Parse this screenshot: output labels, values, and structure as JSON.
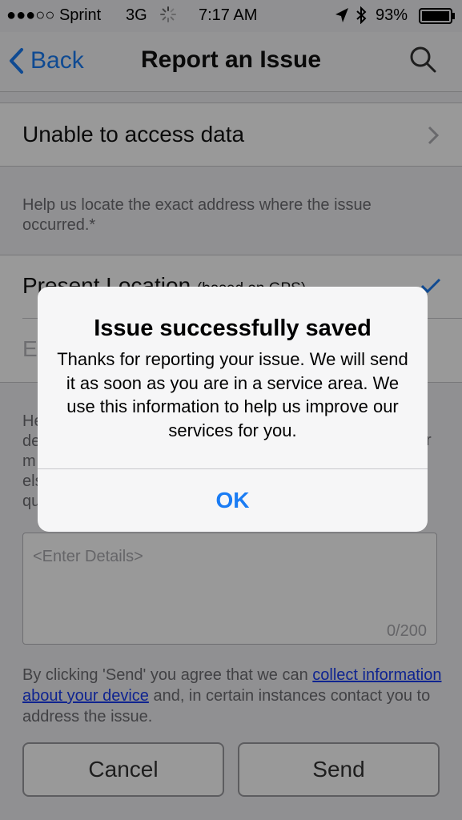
{
  "status_bar": {
    "carrier": "●●●○○ Sprint",
    "network": "3G",
    "time": "7:17 AM",
    "battery": "93%"
  },
  "nav": {
    "back_label": "Back",
    "title": "Report an Issue"
  },
  "form": {
    "issue_type": "Unable to access data",
    "location_help": "Help us locate the exact address where the issue occurred.*",
    "location_option": "Present Location",
    "location_option_note": "(based on GPS)",
    "enter_address_placeholder": "E",
    "details_help_fragments": [
      "He",
      "de",
      "m",
      "els",
      "qu"
    ],
    "details_help_tail": "r",
    "details_placeholder": "<Enter Details>",
    "details_count": "0/200",
    "consent_prefix": "By clicking 'Send' you agree that we can ",
    "consent_link": "collect information about your device",
    "consent_suffix": " and, in certain instances contact you to address the issue.",
    "cancel_label": "Cancel",
    "send_label": "Send"
  },
  "alert": {
    "title": "Issue successfully saved",
    "message": "Thanks for reporting your issue. We will send it as soon as you are in a service area. We use this information to help us improve our services for you.",
    "ok_label": "OK"
  },
  "colors": {
    "accent": "#1a7cf4",
    "link": "#1a3cf0"
  }
}
